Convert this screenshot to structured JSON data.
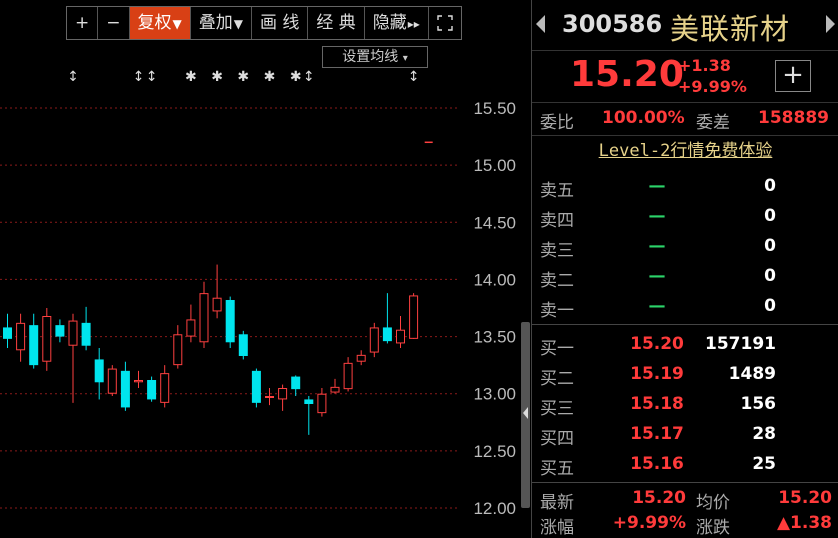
{
  "toolbar": {
    "zoom_in": "+",
    "zoom_out": "−",
    "restore_rights": "复权",
    "overlay": "叠加",
    "draw_line": "画 线",
    "classic": "经 典",
    "hide": "隐藏",
    "arrow_down": "▼",
    "arrows_right": "▸▸",
    "fullscreen_icon": "fullscreen-icon"
  },
  "ma_setting": {
    "label": "设置均线",
    "arrow": "▾"
  },
  "chart_data": {
    "type": "candlestick",
    "y_ticks": [
      "15.50",
      "15.00",
      "14.50",
      "14.00",
      "13.50",
      "13.00",
      "12.50",
      "12.00"
    ],
    "ylim": [
      12.0,
      15.5
    ],
    "colors": {
      "up": "#ff4040",
      "down": "#00e5ee",
      "grid": "#8a1a1a",
      "axis_text": "#bbbbbb"
    },
    "candles": [
      {
        "o": 13.58,
        "c": 13.48,
        "h": 13.7,
        "l": 13.4
      },
      {
        "o": 13.38,
        "c": 13.62,
        "h": 13.7,
        "l": 13.28
      },
      {
        "o": 13.6,
        "c": 13.25,
        "h": 13.7,
        "l": 13.22
      },
      {
        "o": 13.28,
        "c": 13.68,
        "h": 13.75,
        "l": 13.2
      },
      {
        "o": 13.6,
        "c": 13.5,
        "h": 13.65,
        "l": 13.45
      },
      {
        "o": 13.42,
        "c": 13.64,
        "h": 13.7,
        "l": 12.92
      },
      {
        "o": 13.62,
        "c": 13.42,
        "h": 13.76,
        "l": 13.38
      },
      {
        "o": 13.3,
        "c": 13.1,
        "h": 13.4,
        "l": 12.95
      },
      {
        "o": 13.0,
        "c": 13.22,
        "h": 13.25,
        "l": 12.98
      },
      {
        "o": 13.2,
        "c": 12.88,
        "h": 13.28,
        "l": 12.85
      },
      {
        "o": 13.1,
        "c": 13.12,
        "h": 13.2,
        "l": 13.05
      },
      {
        "o": 13.12,
        "c": 12.95,
        "h": 13.15,
        "l": 12.93
      },
      {
        "o": 12.92,
        "c": 13.18,
        "h": 13.25,
        "l": 12.88
      },
      {
        "o": 13.25,
        "c": 13.52,
        "h": 13.6,
        "l": 13.22
      },
      {
        "o": 13.5,
        "c": 13.65,
        "h": 13.78,
        "l": 13.45
      },
      {
        "o": 13.45,
        "c": 13.88,
        "h": 13.98,
        "l": 13.4
      },
      {
        "o": 13.72,
        "c": 13.84,
        "h": 14.13,
        "l": 13.66
      },
      {
        "o": 13.82,
        "c": 13.45,
        "h": 13.85,
        "l": 13.4
      },
      {
        "o": 13.52,
        "c": 13.33,
        "h": 13.55,
        "l": 13.3
      },
      {
        "o": 13.2,
        "c": 12.92,
        "h": 13.22,
        "l": 12.88
      },
      {
        "o": 12.98,
        "c": 12.98,
        "h": 13.05,
        "l": 12.9
      },
      {
        "o": 12.95,
        "c": 13.05,
        "h": 13.08,
        "l": 12.85
      },
      {
        "o": 13.15,
        "c": 13.04,
        "h": 13.16,
        "l": 12.98
      },
      {
        "o": 12.95,
        "c": 12.91,
        "h": 12.98,
        "l": 12.64
      },
      {
        "o": 12.83,
        "c": 13.0,
        "h": 13.05,
        "l": 12.8
      },
      {
        "o": 13.01,
        "c": 13.06,
        "h": 13.13,
        "l": 13.0
      },
      {
        "o": 13.04,
        "c": 13.27,
        "h": 13.32,
        "l": 13.02
      },
      {
        "o": 13.28,
        "c": 13.34,
        "h": 13.38,
        "l": 13.25
      },
      {
        "o": 13.36,
        "c": 13.58,
        "h": 13.62,
        "l": 13.32
      },
      {
        "o": 13.58,
        "c": 13.46,
        "h": 13.88,
        "l": 13.44
      },
      {
        "o": 13.44,
        "c": 13.56,
        "h": 13.68,
        "l": 13.4
      },
      {
        "o": 13.48,
        "c": 13.86,
        "h": 13.88,
        "l": 13.48
      }
    ],
    "last_tick": 15.2,
    "markers": [
      {
        "index": 5,
        "symbol": "↕"
      },
      {
        "index": 10,
        "symbol": "↕"
      },
      {
        "index": 11,
        "symbol": "↕"
      },
      {
        "index": 14,
        "symbol": "✱"
      },
      {
        "index": 16,
        "symbol": "✱"
      },
      {
        "index": 18,
        "symbol": "✱"
      },
      {
        "index": 20,
        "symbol": "✱"
      },
      {
        "index": 22,
        "symbol": "✱"
      },
      {
        "index": 23,
        "symbol": "↕"
      },
      {
        "index": 31,
        "symbol": "↕"
      }
    ]
  },
  "stock": {
    "code": "300586",
    "name": "美联新材",
    "price": "15.20",
    "change": "+1.38",
    "change_pct": "+9.99%",
    "add_label": "+"
  },
  "ratio": {
    "bid_ratio_label": "委比",
    "bid_ratio_value": "100.00%",
    "bid_diff_label": "委差",
    "bid_diff_value": "158889"
  },
  "level2_promo": "Level-2行情免费体验",
  "order_book": {
    "asks": [
      {
        "label": "卖五",
        "price": "—",
        "volume": "0"
      },
      {
        "label": "卖四",
        "price": "—",
        "volume": "0"
      },
      {
        "label": "卖三",
        "price": "—",
        "volume": "0"
      },
      {
        "label": "卖二",
        "price": "—",
        "volume": "0"
      },
      {
        "label": "卖一",
        "price": "—",
        "volume": "0"
      }
    ],
    "bids": [
      {
        "label": "买一",
        "price": "15.20",
        "volume": "157191"
      },
      {
        "label": "买二",
        "price": "15.19",
        "volume": "1489"
      },
      {
        "label": "买三",
        "price": "15.18",
        "volume": "156"
      },
      {
        "label": "买四",
        "price": "15.17",
        "volume": "28"
      },
      {
        "label": "买五",
        "price": "15.16",
        "volume": "25"
      }
    ]
  },
  "footer": {
    "latest_label": "最新",
    "latest_value": "15.20",
    "avg_label": "均价",
    "avg_value": "15.20",
    "pct_label": "涨幅",
    "pct_value": "+9.99%",
    "chg_label": "涨跌",
    "chg_value": "▲1.38"
  }
}
